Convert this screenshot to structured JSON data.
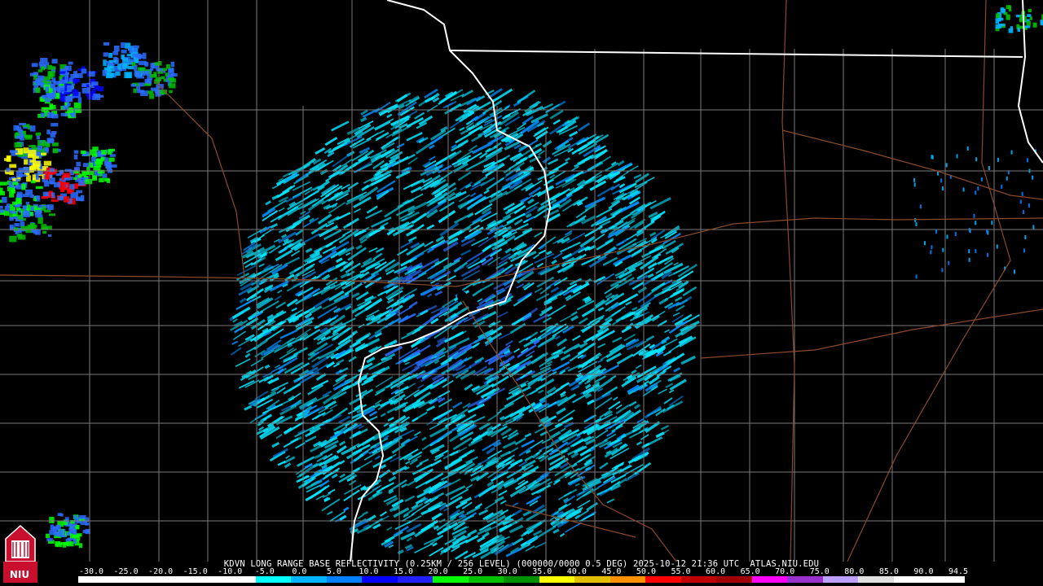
{
  "caption": "KDVN LONG RANGE BASE REFLECTIVITY (0.25KM / 256 LEVEL) (000000/0000 0.5 DEG) 2025-10-12 21:36 UTC  ATLAS.NIU.EDU",
  "logo_text": "NIU",
  "scale": {
    "labels": [
      "-30.0",
      "-25.0",
      "-20.0",
      "-15.0",
      "-10.0",
      "-5.0",
      "0.0",
      "5.0",
      "10.0",
      "15.0",
      "20.0",
      "25.0",
      "30.0",
      "35.0",
      "40.0",
      "45.0",
      "50.0",
      "55.0",
      "60.0",
      "65.0",
      "70.0",
      "75.0",
      "80.0",
      "85.0",
      "90.0",
      "94.5"
    ],
    "colors": [
      "#000000",
      "#000000",
      "#000000",
      "#000000",
      "#000000",
      "#00ffff",
      "#00b4ff",
      "#0080ff",
      "#0000ff",
      "#2020ff",
      "#00ff00",
      "#00c000",
      "#009000",
      "#ffff00",
      "#e0c000",
      "#ff9000",
      "#ff0000",
      "#c00000",
      "#a00000",
      "#ff00ff",
      "#9932cc",
      "#c0a0ff",
      "#e0e0e0",
      "#ffffff",
      "#ffffff"
    ]
  },
  "colors": {
    "background": "#000000",
    "county_lines": "#7a7a7a",
    "state_lines": "#ffffff",
    "highways": "#8b4a2b",
    "radar_base": "#00ffff"
  }
}
